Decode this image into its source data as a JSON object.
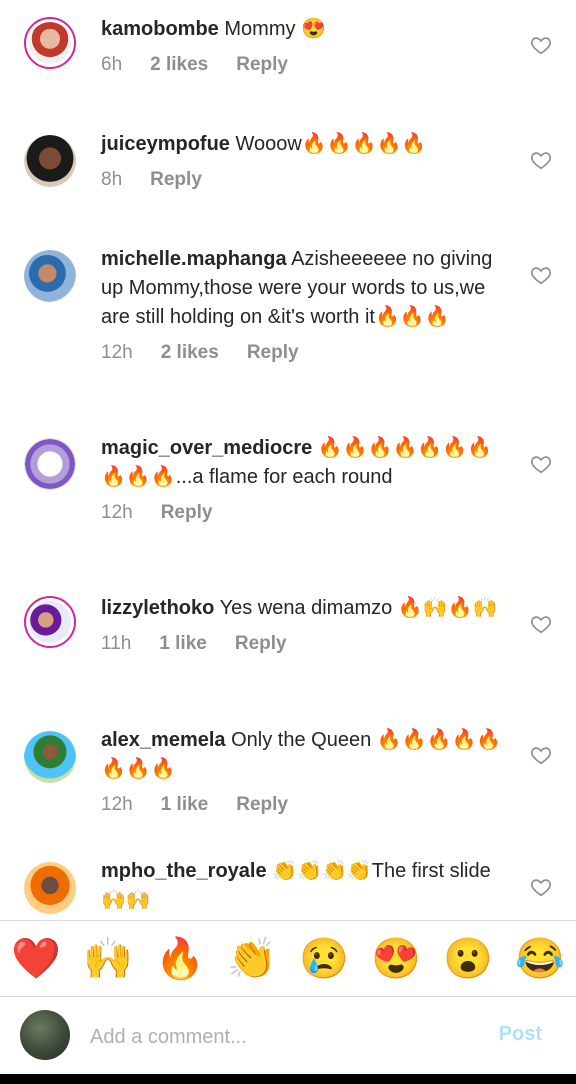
{
  "comments": [
    {
      "user": "kamobombe",
      "text": "Mommy 😍",
      "time": "6h",
      "likes": "2 likes",
      "reply": "Reply"
    },
    {
      "user": "juiceympofue",
      "text": "Wooow🔥🔥🔥🔥🔥",
      "time": "8h",
      "reply": "Reply"
    },
    {
      "user": "michelle.maphanga",
      "text": "Azisheeeeee no giving up Mommy,those were your words to us,we are still holding on &it's worth it🔥🔥🔥",
      "time": "12h",
      "likes": "2 likes",
      "reply": "Reply"
    },
    {
      "user": "magic_over_mediocre",
      "text": "🔥🔥🔥🔥🔥🔥🔥🔥🔥🔥...a flame for each round",
      "time": "12h",
      "reply": "Reply"
    },
    {
      "user": "lizzylethoko",
      "text": "Yes wena dimamzo 🔥🙌🔥🙌",
      "time": "11h",
      "likes": "1 like",
      "reply": "Reply"
    },
    {
      "user": "alex_memela",
      "text": "Only the Queen 🔥🔥🔥🔥🔥🔥🔥🔥",
      "time": "12h",
      "likes": "1 like",
      "reply": "Reply"
    },
    {
      "user": "mpho_the_royale",
      "text": "👏👏👏👏The first slide🙌🙌",
      "time": "",
      "reply": ""
    }
  ],
  "quick_reactions": [
    "❤️",
    "🙌",
    "🔥",
    "👏",
    "😢",
    "😍",
    "😮",
    "😂"
  ],
  "composer": {
    "placeholder": "Add a comment...",
    "post_label": "Post"
  },
  "colors": {
    "heart_outline": "#8e8e8e",
    "post_disabled": "#b2dffc",
    "story_ring": "#d6249f"
  }
}
